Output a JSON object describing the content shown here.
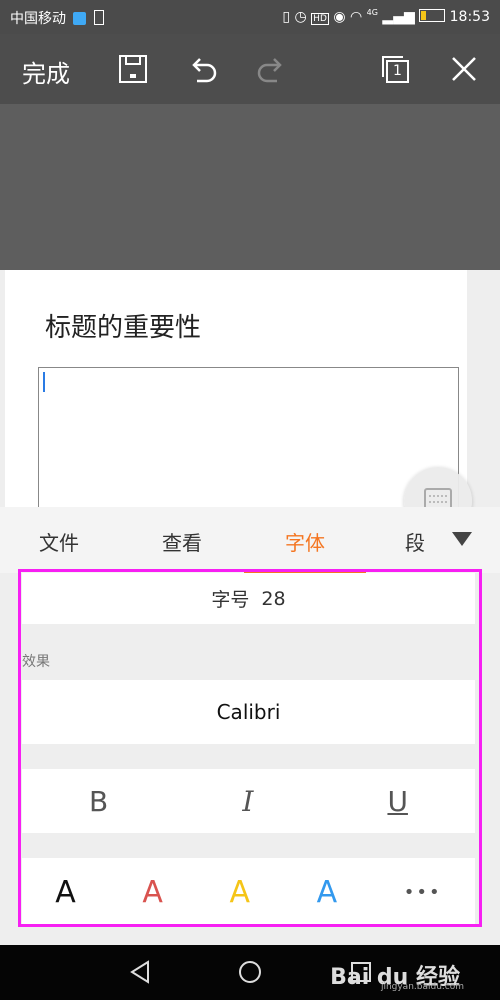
{
  "status_bar": {
    "carrier": "中国移动",
    "time": "18:53",
    "network": "4G"
  },
  "toolbar": {
    "done_label": "完成",
    "page_count": "1"
  },
  "document": {
    "title": "标题的重要性"
  },
  "tabs": [
    {
      "label": "文件"
    },
    {
      "label": "查看"
    },
    {
      "label": "字体"
    },
    {
      "label": "段"
    }
  ],
  "active_tab": "字体",
  "panel": {
    "font_size_label": "字号",
    "font_size_value": "28",
    "effect_label": "效果",
    "font_name": "Calibri",
    "style_buttons": [
      "B",
      "I",
      "U"
    ],
    "color_letters": [
      {
        "label": "A",
        "color": "#111111"
      },
      {
        "label": "A",
        "color": "#d9534f"
      },
      {
        "label": "A",
        "color": "#f5c518"
      },
      {
        "label": "A",
        "color": "#3399ee"
      }
    ],
    "more_label": "•••"
  },
  "watermark": {
    "brand": "Bai du 经验",
    "url": "jingyan.baidu.com"
  },
  "colors": {
    "accent": "#f47622",
    "highlight": "#f71ff3",
    "cursor": "#2a7be4"
  }
}
